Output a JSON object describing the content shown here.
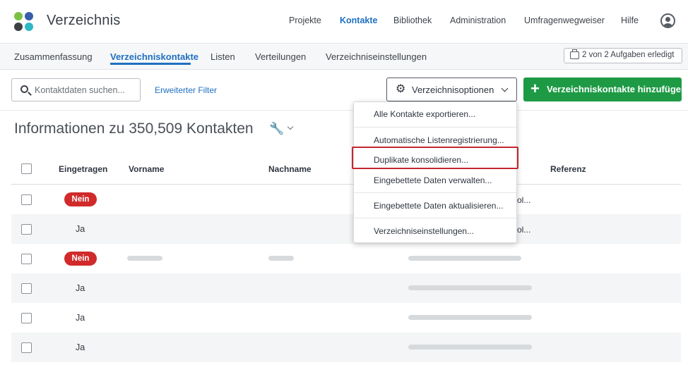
{
  "brand": {
    "title": "Verzeichnis",
    "logo_colors": [
      "#7ac143",
      "#3a5dab",
      "#3e4046",
      "#2eb9c3"
    ]
  },
  "topnav": [
    {
      "label": "Projekte",
      "active": false
    },
    {
      "label": "Kontakte",
      "active": true
    },
    {
      "label": "Bibliothek",
      "active": false
    },
    {
      "label": "Administration",
      "active": false
    },
    {
      "label": "Umfragenwegweiser",
      "active": false
    },
    {
      "label": "Hilfe",
      "active": false
    }
  ],
  "subnav": [
    {
      "label": "Zusammenfassung",
      "active": false
    },
    {
      "label": "Verzeichniskontakte",
      "active": true
    },
    {
      "label": "Listen",
      "active": false
    },
    {
      "label": "Verteilungen",
      "active": false
    },
    {
      "label": "Verzeichniseinstellungen",
      "active": false
    }
  ],
  "tasks_badge": "2 von 2 Aufgaben erledigt",
  "toolbar": {
    "search_placeholder": "Kontaktdaten suchen...",
    "advanced_filter": "Erweiterter Filter",
    "directory_options": "Verzeichnisoptionen",
    "add_contacts": "Verzeichniskontakte hinzufügen"
  },
  "heading": "Informationen zu 350,509 Kontakten",
  "table": {
    "columns": [
      "Eingetragen",
      "Vorname",
      "Nachname",
      "Referenz"
    ],
    "rows": [
      {
        "subscribed": "Nein",
        "status": "negative",
        "trailing": "ol..."
      },
      {
        "subscribed": "Ja",
        "status": "positive",
        "trailing": "ol..."
      },
      {
        "subscribed": "Nein",
        "status": "negative",
        "trailing": ""
      },
      {
        "subscribed": "Ja",
        "status": "positive",
        "trailing": ""
      },
      {
        "subscribed": "Ja",
        "status": "positive",
        "trailing": ""
      },
      {
        "subscribed": "Ja",
        "status": "positive",
        "trailing": ""
      }
    ]
  },
  "menu": {
    "items": [
      "Alle Kontakte exportieren...",
      "Automatische Listenregistrierung...",
      "Duplikate konsolidieren...",
      "Eingebettete Daten verwalten...",
      "Eingebettete Daten aktualisieren...",
      "Verzeichniseinstellungen..."
    ],
    "highlighted_index": 2
  },
  "colors": {
    "accent": "#1f70c1",
    "add_button": "#1e9a45",
    "negative_pill": "#d12a2a",
    "highlight": "#c4262e"
  }
}
